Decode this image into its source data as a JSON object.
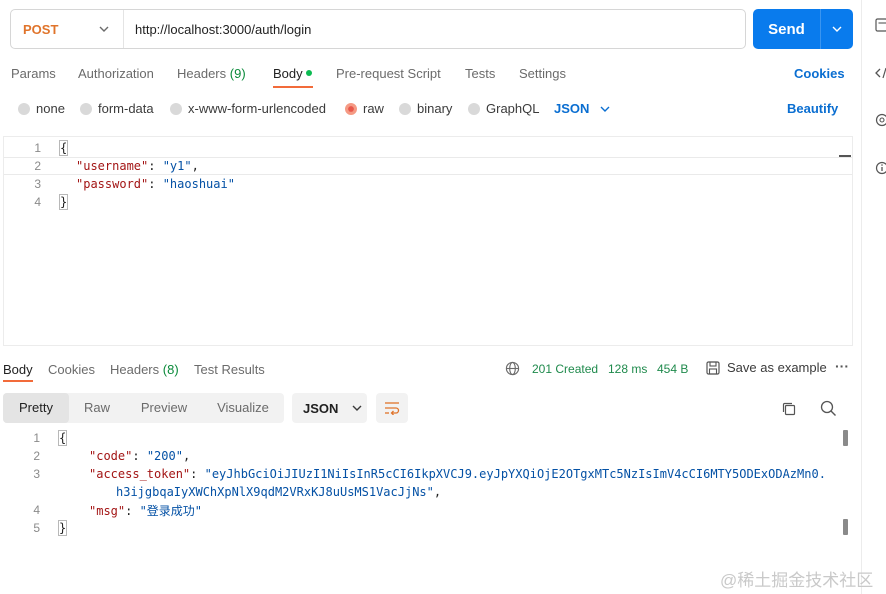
{
  "request": {
    "method": "POST",
    "url": "http://localhost:3000/auth/login",
    "send_label": "Send"
  },
  "request_tabs": [
    {
      "label": "Params"
    },
    {
      "label": "Authorization"
    },
    {
      "label": "Headers",
      "count": "(9)"
    },
    {
      "label": "Body",
      "active": true
    },
    {
      "label": "Pre-request Script"
    },
    {
      "label": "Tests"
    },
    {
      "label": "Settings"
    }
  ],
  "cookies_label": "Cookies",
  "body_types": [
    {
      "label": "none"
    },
    {
      "label": "form-data"
    },
    {
      "label": "x-www-form-urlencoded"
    },
    {
      "label": "raw",
      "selected": true
    },
    {
      "label": "binary"
    },
    {
      "label": "GraphQL"
    }
  ],
  "body_format": "JSON",
  "beautify_label": "Beautify",
  "request_body": {
    "line_numbers": [
      "1",
      "2",
      "3",
      "4"
    ],
    "open": "{",
    "k1": "\"username\"",
    "v1": "\"y1\"",
    "k2": "\"password\"",
    "v2": "\"haoshuai\"",
    "close": "}"
  },
  "response_tabs": [
    {
      "label": "Body",
      "active": true
    },
    {
      "label": "Cookies"
    },
    {
      "label": "Headers",
      "count": "(8)"
    },
    {
      "label": "Test Results"
    }
  ],
  "response_status": {
    "status": "201 Created",
    "time": "128 ms",
    "size": "454 B"
  },
  "save_example_label": "Save as example",
  "more_label": "···",
  "view_modes": [
    "Pretty",
    "Raw",
    "Preview",
    "Visualize"
  ],
  "response_format": "JSON",
  "response_body": {
    "line_numbers": [
      "1",
      "2",
      "3",
      "",
      "4",
      "5"
    ],
    "open": "{",
    "k1": "\"code\"",
    "v1": "\"200\"",
    "k2": "\"access_token\"",
    "v2a": "\"eyJhbGciOiJIUzI1NiIsInR5cCI6IkpXVCJ9.eyJpYXQiOjE2OTgxMTc5NzIsImV4cCI6MTY5ODExODAzMn0.",
    "v2b": "h3ijgbqaIyXWChXpNlX9qdM2VRxKJ8uUsMS1VacJjNs\"",
    "k3": "\"msg\"",
    "v3": "\"登录成功\"",
    "close": "}"
  },
  "watermark": "@稀土掘金技术社区",
  "colors": {
    "accent": "#097bed",
    "method": "#e0742b",
    "tab_active": "#f26b3a",
    "status_ok": "#1f8a4c",
    "link": "#0a6ed1"
  }
}
